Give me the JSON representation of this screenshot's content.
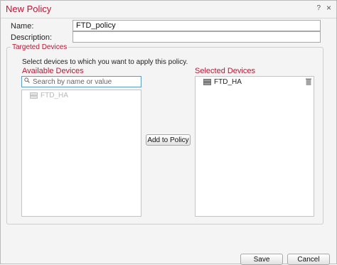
{
  "dialog": {
    "title": "New Policy",
    "help": "?",
    "close": "×"
  },
  "form": {
    "name_label": "Name:",
    "name_value": "FTD_policy",
    "description_label": "Description:",
    "description_value": ""
  },
  "targeted": {
    "legend": "Targeted Devices",
    "instruction": "Select devices to which you want to apply this policy.",
    "available_title": "Available Devices",
    "search_placeholder": "Search by name or value",
    "available_items": [
      {
        "label": "FTD_HA",
        "disabled": true
      }
    ],
    "add_button": "Add to Policy",
    "selected_title": "Selected Devices",
    "selected_items": [
      {
        "label": "FTD_HA"
      }
    ]
  },
  "footer": {
    "save": "Save",
    "cancel": "Cancel"
  },
  "colors": {
    "accent": "#c8102e",
    "search_border": "#5b9bd5"
  }
}
